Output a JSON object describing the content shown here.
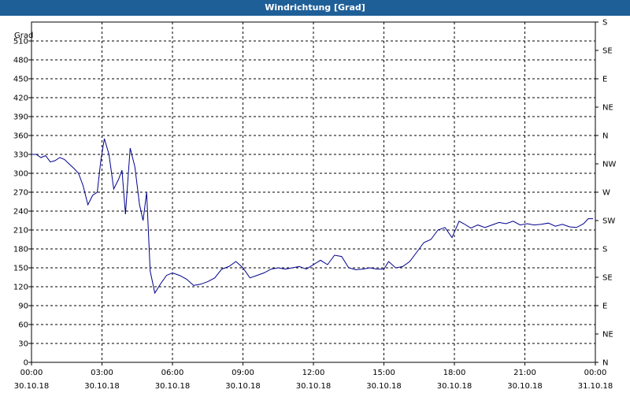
{
  "window": {
    "title": "Windrichtung [Grad]"
  },
  "colors": {
    "title_bar": "#1f5f98",
    "series": "#00008b",
    "grid": "#000000"
  },
  "chart_data": {
    "type": "line",
    "title": "Windrichtung [Grad]",
    "ylabel": "Grad",
    "xlabel": "",
    "ylim": [
      0,
      540
    ],
    "xlim": [
      0,
      24
    ],
    "grid": true,
    "x_ticks": [
      {
        "hour": 0,
        "time": "00:00",
        "date": "30.10.18"
      },
      {
        "hour": 3,
        "time": "03:00",
        "date": "30.10.18"
      },
      {
        "hour": 6,
        "time": "06:00",
        "date": "30.10.18"
      },
      {
        "hour": 9,
        "time": "09:00",
        "date": "30.10.18"
      },
      {
        "hour": 12,
        "time": "12:00",
        "date": "30.10.18"
      },
      {
        "hour": 15,
        "time": "15:00",
        "date": "30.10.18"
      },
      {
        "hour": 18,
        "time": "18:00",
        "date": "30.10.18"
      },
      {
        "hour": 21,
        "time": "21:00",
        "date": "30.10.18"
      },
      {
        "hour": 24,
        "time": "00:00",
        "date": "31.10.18"
      }
    ],
    "y_ticks": [
      0,
      30,
      60,
      90,
      120,
      150,
      180,
      210,
      240,
      270,
      300,
      330,
      360,
      390,
      420,
      450,
      480,
      510
    ],
    "right_axis_labels": [
      {
        "value": 0,
        "label": "N"
      },
      {
        "value": 45,
        "label": "NE"
      },
      {
        "value": 90,
        "label": "E"
      },
      {
        "value": 135,
        "label": "SE"
      },
      {
        "value": 180,
        "label": "S"
      },
      {
        "value": 225,
        "label": "SW"
      },
      {
        "value": 270,
        "label": "W"
      },
      {
        "value": 315,
        "label": "NW"
      },
      {
        "value": 360,
        "label": "N"
      },
      {
        "value": 405,
        "label": "NE"
      },
      {
        "value": 450,
        "label": "E"
      },
      {
        "value": 495,
        "label": "SE"
      },
      {
        "value": 540,
        "label": "S"
      }
    ],
    "series": [
      {
        "x": [
          0.0,
          0.2,
          0.4,
          0.6,
          0.8,
          1.0,
          1.2,
          1.4,
          1.6,
          1.8,
          2.0,
          2.2,
          2.4,
          2.6,
          2.8,
          2.95,
          3.1,
          3.3,
          3.5,
          3.7,
          3.85,
          4.0,
          4.2,
          4.4,
          4.6,
          4.75,
          4.9,
          5.05,
          5.25,
          5.5,
          5.75,
          6.0,
          6.3,
          6.6,
          6.9,
          7.2,
          7.5,
          7.8,
          8.1,
          8.4,
          8.7,
          9.0,
          9.3,
          9.6,
          9.9,
          10.2,
          10.5,
          10.8,
          11.1,
          11.4,
          11.7,
          12.0,
          12.3,
          12.6,
          12.9,
          13.2,
          13.5,
          13.8,
          14.1,
          14.4,
          14.7,
          15.0,
          15.2,
          15.5,
          15.8,
          16.1,
          16.4,
          16.7,
          17.0,
          17.3,
          17.6,
          17.9,
          18.2,
          18.4,
          18.7,
          19.0,
          19.3,
          19.6,
          19.9,
          20.2,
          20.5,
          20.8,
          21.1,
          21.4,
          21.7,
          22.0,
          22.3,
          22.6,
          22.9,
          23.2,
          23.5,
          23.7,
          23.9
        ],
        "y": [
          330,
          330,
          325,
          328,
          318,
          320,
          325,
          322,
          315,
          308,
          300,
          280,
          250,
          265,
          270,
          320,
          355,
          330,
          275,
          290,
          305,
          235,
          340,
          310,
          250,
          225,
          270,
          145,
          110,
          125,
          138,
          142,
          138,
          132,
          122,
          124,
          128,
          134,
          148,
          152,
          160,
          150,
          134,
          138,
          142,
          148,
          150,
          148,
          150,
          152,
          148,
          155,
          162,
          155,
          170,
          168,
          150,
          147,
          148,
          150,
          148,
          148,
          160,
          150,
          152,
          160,
          175,
          190,
          195,
          210,
          214,
          198,
          224,
          220,
          213,
          218,
          214,
          218,
          222,
          220,
          224,
          218,
          220,
          218,
          219,
          221,
          216,
          219,
          215,
          214,
          220,
          228,
          228
        ]
      }
    ]
  }
}
